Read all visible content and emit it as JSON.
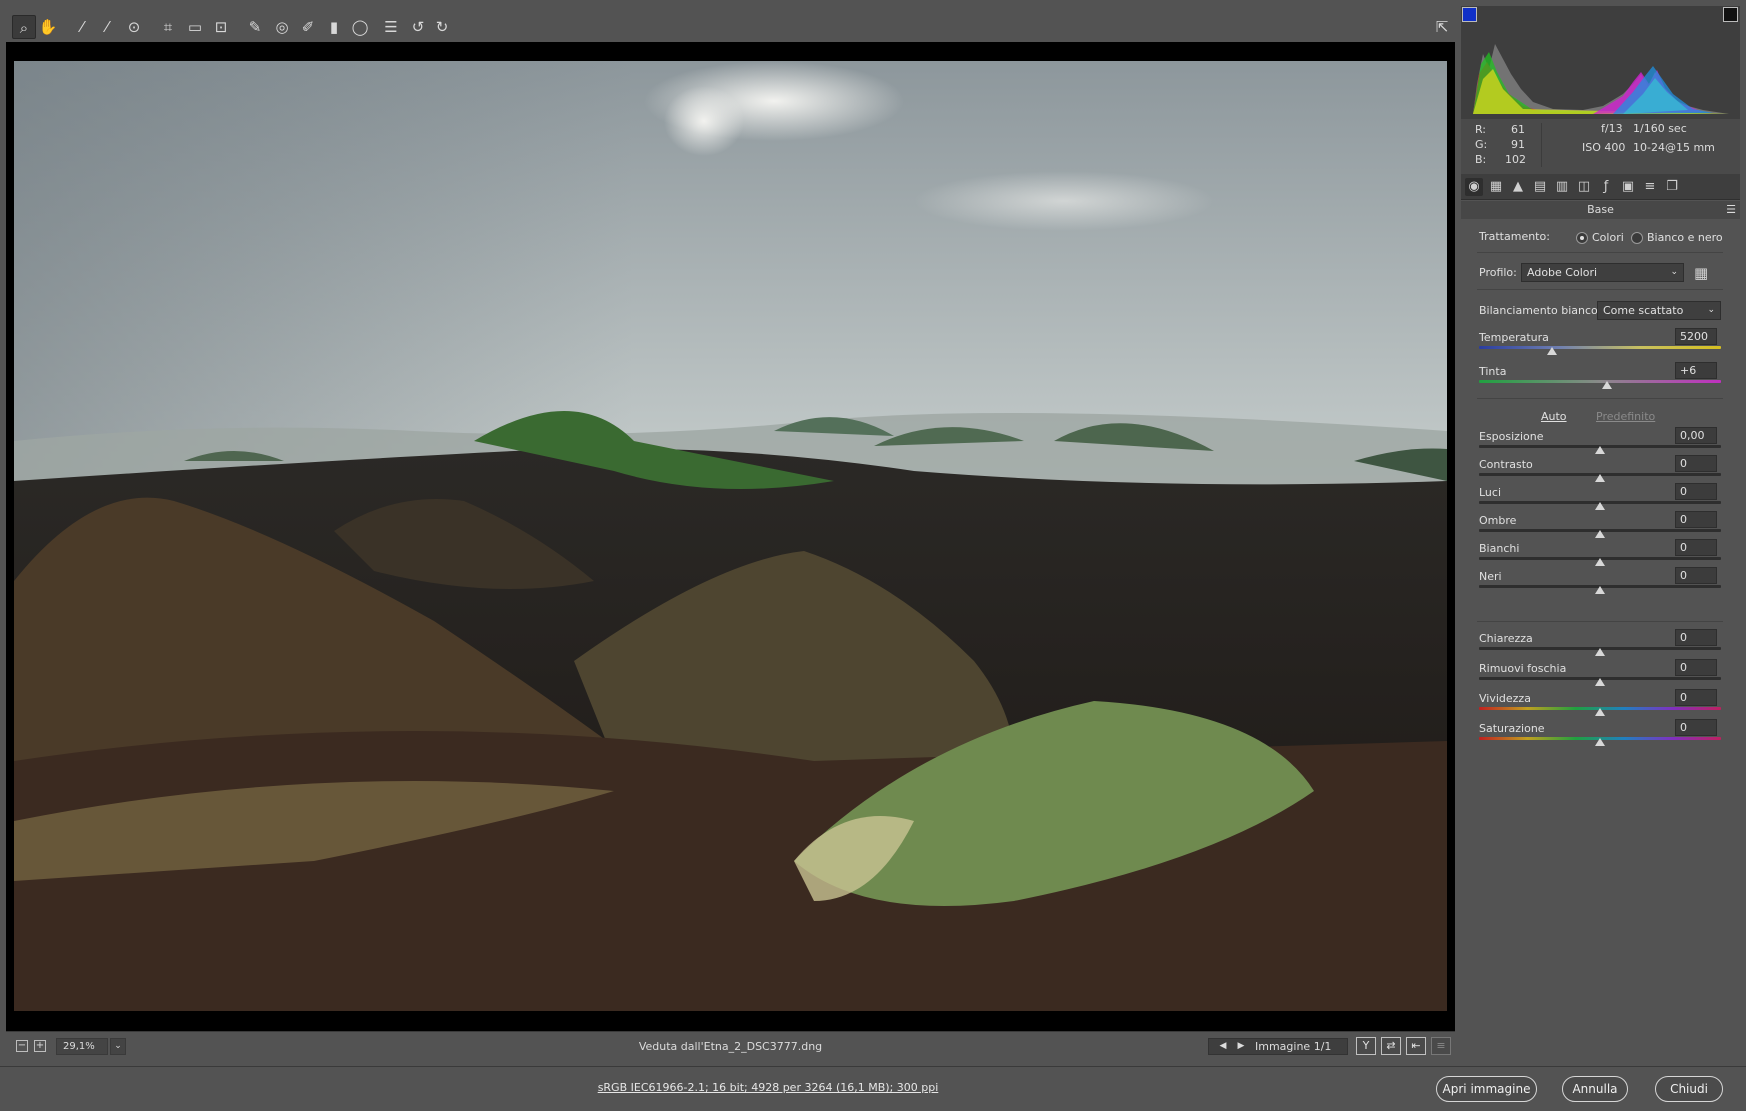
{
  "toolbar": {
    "tools": [
      {
        "name": "zoom-tool",
        "icon": "magnifier-icon",
        "glyph": "⌕"
      },
      {
        "name": "hand-tool",
        "icon": "hand-icon",
        "glyph": "✋"
      },
      {
        "name": "white-balance-tool",
        "icon": "eyedropper-icon",
        "glyph": "⁄"
      },
      {
        "name": "color-sampler-tool",
        "icon": "eyedropper-plus-icon",
        "glyph": "⁄"
      },
      {
        "name": "targeted-adjustment-tool",
        "icon": "target-adjust-icon",
        "glyph": "⊙"
      },
      {
        "name": "crop-tool",
        "icon": "crop-icon",
        "glyph": "⌗"
      },
      {
        "name": "straighten-tool",
        "icon": "level-icon",
        "glyph": "▭"
      },
      {
        "name": "transform-tool",
        "icon": "transform-icon",
        "glyph": "⊡"
      },
      {
        "name": "spot-removal-tool",
        "icon": "brush-heal-icon",
        "glyph": "✎"
      },
      {
        "name": "red-eye-tool",
        "icon": "red-eye-icon",
        "glyph": "◎"
      },
      {
        "name": "adjustment-brush-tool",
        "icon": "brush-icon",
        "glyph": "✐"
      },
      {
        "name": "graduated-filter-tool",
        "icon": "graduated-filter-icon",
        "glyph": "▮"
      },
      {
        "name": "radial-filter-tool",
        "icon": "radial-filter-icon",
        "glyph": "◯"
      },
      {
        "name": "preferences-tool",
        "icon": "list-icon",
        "glyph": "☰"
      },
      {
        "name": "rotate-left-tool",
        "icon": "rotate-ccw-icon",
        "glyph": "↺"
      },
      {
        "name": "rotate-right-tool",
        "icon": "rotate-cw-icon",
        "glyph": "↻"
      }
    ],
    "fullscreen_icon": "fullscreen-icon"
  },
  "status": {
    "zoom_out": "−",
    "zoom_in": "+",
    "zoom": "29,1%",
    "filename": "Veduta dall'Etna_2_DSC3777.dng",
    "prev": "◀",
    "next": "▶",
    "image_count": "Immagine 1/1",
    "before_after_toggle": "Y",
    "swap_settings": "⇄",
    "copy_settings": "⇤",
    "toggle_settings": "≡"
  },
  "readout": {
    "r_label": "R:",
    "r": "61",
    "g_label": "G:",
    "g": "91",
    "b_label": "B:",
    "b": "102",
    "aperture": "f/13",
    "shutter": "1/160 sec",
    "iso": "ISO 400",
    "lens": "10-24@15 mm"
  },
  "panel": {
    "title": "Base",
    "treatment_label": "Trattamento:",
    "treatment_color": "Colori",
    "treatment_bw": "Bianco e nero",
    "profile_label": "Profilo:",
    "profile_value": "Adobe Colori",
    "wb_label": "Bilanciamento bianco:",
    "wb_value": "Come scattato",
    "auto": "Auto",
    "default": "Predefinito",
    "temperature": {
      "label": "Temperatura",
      "value": "5200",
      "level": 0.3
    },
    "tint": {
      "label": "Tinta",
      "value": "+6",
      "level": 0.53
    },
    "tone": [
      {
        "label": "Esposizione",
        "value": "0,00",
        "level": 0.5
      },
      {
        "label": "Contrasto",
        "value": "0",
        "level": 0.5
      },
      {
        "label": "Luci",
        "value": "0",
        "level": 0.5
      },
      {
        "label": "Ombre",
        "value": "0",
        "level": 0.5
      },
      {
        "label": "Bianchi",
        "value": "0",
        "level": 0.5
      },
      {
        "label": "Neri",
        "value": "0",
        "level": 0.5
      }
    ],
    "presence": [
      {
        "label": "Chiarezza",
        "value": "0",
        "level": 0.5
      },
      {
        "label": "Rimuovi foschia",
        "value": "0",
        "level": 0.5
      },
      {
        "label": "Vividezza",
        "value": "0",
        "level": 0.5
      },
      {
        "label": "Saturazione",
        "value": "0",
        "level": 0.5
      }
    ]
  },
  "bottom": {
    "workflow": "sRGB IEC61966-2.1; 16 bit; 4928 per 3264 (16,1 MB); 300 ppi",
    "open": "Apri immagine",
    "cancel": "Annulla",
    "close": "Chiudi"
  }
}
